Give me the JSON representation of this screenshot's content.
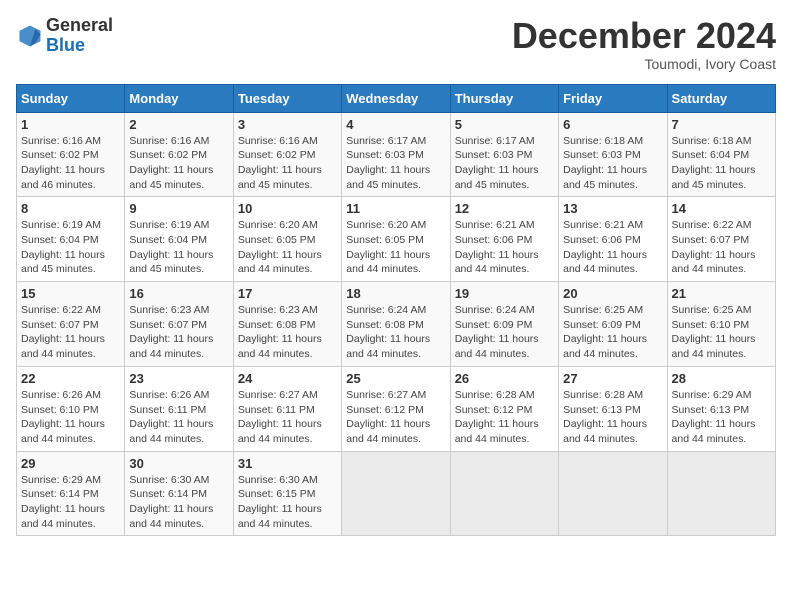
{
  "header": {
    "logo_general": "General",
    "logo_blue": "Blue",
    "month_title": "December 2024",
    "subtitle": "Toumodi, Ivory Coast"
  },
  "days_of_week": [
    "Sunday",
    "Monday",
    "Tuesday",
    "Wednesday",
    "Thursday",
    "Friday",
    "Saturday"
  ],
  "weeks": [
    [
      {
        "day": "1",
        "info": "Sunrise: 6:16 AM\nSunset: 6:02 PM\nDaylight: 11 hours and 46 minutes."
      },
      {
        "day": "2",
        "info": "Sunrise: 6:16 AM\nSunset: 6:02 PM\nDaylight: 11 hours and 45 minutes."
      },
      {
        "day": "3",
        "info": "Sunrise: 6:16 AM\nSunset: 6:02 PM\nDaylight: 11 hours and 45 minutes."
      },
      {
        "day": "4",
        "info": "Sunrise: 6:17 AM\nSunset: 6:03 PM\nDaylight: 11 hours and 45 minutes."
      },
      {
        "day": "5",
        "info": "Sunrise: 6:17 AM\nSunset: 6:03 PM\nDaylight: 11 hours and 45 minutes."
      },
      {
        "day": "6",
        "info": "Sunrise: 6:18 AM\nSunset: 6:03 PM\nDaylight: 11 hours and 45 minutes."
      },
      {
        "day": "7",
        "info": "Sunrise: 6:18 AM\nSunset: 6:04 PM\nDaylight: 11 hours and 45 minutes."
      }
    ],
    [
      {
        "day": "8",
        "info": "Sunrise: 6:19 AM\nSunset: 6:04 PM\nDaylight: 11 hours and 45 minutes."
      },
      {
        "day": "9",
        "info": "Sunrise: 6:19 AM\nSunset: 6:04 PM\nDaylight: 11 hours and 45 minutes."
      },
      {
        "day": "10",
        "info": "Sunrise: 6:20 AM\nSunset: 6:05 PM\nDaylight: 11 hours and 44 minutes."
      },
      {
        "day": "11",
        "info": "Sunrise: 6:20 AM\nSunset: 6:05 PM\nDaylight: 11 hours and 44 minutes."
      },
      {
        "day": "12",
        "info": "Sunrise: 6:21 AM\nSunset: 6:06 PM\nDaylight: 11 hours and 44 minutes."
      },
      {
        "day": "13",
        "info": "Sunrise: 6:21 AM\nSunset: 6:06 PM\nDaylight: 11 hours and 44 minutes."
      },
      {
        "day": "14",
        "info": "Sunrise: 6:22 AM\nSunset: 6:07 PM\nDaylight: 11 hours and 44 minutes."
      }
    ],
    [
      {
        "day": "15",
        "info": "Sunrise: 6:22 AM\nSunset: 6:07 PM\nDaylight: 11 hours and 44 minutes."
      },
      {
        "day": "16",
        "info": "Sunrise: 6:23 AM\nSunset: 6:07 PM\nDaylight: 11 hours and 44 minutes."
      },
      {
        "day": "17",
        "info": "Sunrise: 6:23 AM\nSunset: 6:08 PM\nDaylight: 11 hours and 44 minutes."
      },
      {
        "day": "18",
        "info": "Sunrise: 6:24 AM\nSunset: 6:08 PM\nDaylight: 11 hours and 44 minutes."
      },
      {
        "day": "19",
        "info": "Sunrise: 6:24 AM\nSunset: 6:09 PM\nDaylight: 11 hours and 44 minutes."
      },
      {
        "day": "20",
        "info": "Sunrise: 6:25 AM\nSunset: 6:09 PM\nDaylight: 11 hours and 44 minutes."
      },
      {
        "day": "21",
        "info": "Sunrise: 6:25 AM\nSunset: 6:10 PM\nDaylight: 11 hours and 44 minutes."
      }
    ],
    [
      {
        "day": "22",
        "info": "Sunrise: 6:26 AM\nSunset: 6:10 PM\nDaylight: 11 hours and 44 minutes."
      },
      {
        "day": "23",
        "info": "Sunrise: 6:26 AM\nSunset: 6:11 PM\nDaylight: 11 hours and 44 minutes."
      },
      {
        "day": "24",
        "info": "Sunrise: 6:27 AM\nSunset: 6:11 PM\nDaylight: 11 hours and 44 minutes."
      },
      {
        "day": "25",
        "info": "Sunrise: 6:27 AM\nSunset: 6:12 PM\nDaylight: 11 hours and 44 minutes."
      },
      {
        "day": "26",
        "info": "Sunrise: 6:28 AM\nSunset: 6:12 PM\nDaylight: 11 hours and 44 minutes."
      },
      {
        "day": "27",
        "info": "Sunrise: 6:28 AM\nSunset: 6:13 PM\nDaylight: 11 hours and 44 minutes."
      },
      {
        "day": "28",
        "info": "Sunrise: 6:29 AM\nSunset: 6:13 PM\nDaylight: 11 hours and 44 minutes."
      }
    ],
    [
      {
        "day": "29",
        "info": "Sunrise: 6:29 AM\nSunset: 6:14 PM\nDaylight: 11 hours and 44 minutes."
      },
      {
        "day": "30",
        "info": "Sunrise: 6:30 AM\nSunset: 6:14 PM\nDaylight: 11 hours and 44 minutes."
      },
      {
        "day": "31",
        "info": "Sunrise: 6:30 AM\nSunset: 6:15 PM\nDaylight: 11 hours and 44 minutes."
      },
      {
        "day": "",
        "info": ""
      },
      {
        "day": "",
        "info": ""
      },
      {
        "day": "",
        "info": ""
      },
      {
        "day": "",
        "info": ""
      }
    ]
  ]
}
